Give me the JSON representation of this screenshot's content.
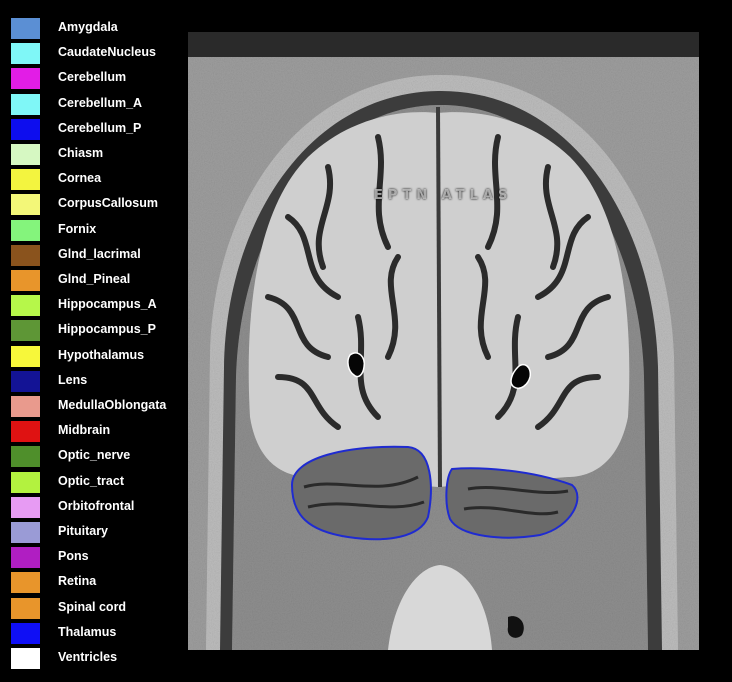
{
  "legend": {
    "items": [
      {
        "label": "Amygdala",
        "color": "#5b8fd4"
      },
      {
        "label": "CaudateNucleus",
        "color": "#7ff7f7"
      },
      {
        "label": "Cerebellum",
        "color": "#e21de6"
      },
      {
        "label": "Cerebellum_A",
        "color": "#7ff7f7"
      },
      {
        "label": "Cerebellum_P",
        "color": "#0d0dee"
      },
      {
        "label": "Chiasm",
        "color": "#d6f8c2"
      },
      {
        "label": "Cornea",
        "color": "#f3f43f"
      },
      {
        "label": "CorpusCallosum",
        "color": "#f3f778"
      },
      {
        "label": "Fornix",
        "color": "#84f47c"
      },
      {
        "label": "Glnd_lacrimal",
        "color": "#8a531d"
      },
      {
        "label": "Glnd_Pineal",
        "color": "#e8952b"
      },
      {
        "label": "Hippocampus_A",
        "color": "#b6f74a"
      },
      {
        "label": "Hippocampus_P",
        "color": "#5e9636"
      },
      {
        "label": "Hypothalamus",
        "color": "#f7f73a"
      },
      {
        "label": "Lens",
        "color": "#131395"
      },
      {
        "label": "MedullaOblongata",
        "color": "#e99a8d"
      },
      {
        "label": "Midbrain",
        "color": "#df1212"
      },
      {
        "label": "Optic_nerve",
        "color": "#4f8f2b"
      },
      {
        "label": "Optic_tract",
        "color": "#b3f23f"
      },
      {
        "label": "Orbitofrontal",
        "color": "#e79bf3"
      },
      {
        "label": "Pituitary",
        "color": "#9a9bd6"
      },
      {
        "label": "Pons",
        "color": "#b01ec2"
      },
      {
        "label": "Retina",
        "color": "#e8952b"
      },
      {
        "label": "Spinal cord",
        "color": "#e8952b"
      },
      {
        "label": "Thalamus",
        "color": "#0f0ff5"
      },
      {
        "label": "Ventricles",
        "color": "#ffffff"
      }
    ]
  },
  "viewer": {
    "watermark": "EPTN ATLAS",
    "outline_color": "#1f2bd0"
  }
}
